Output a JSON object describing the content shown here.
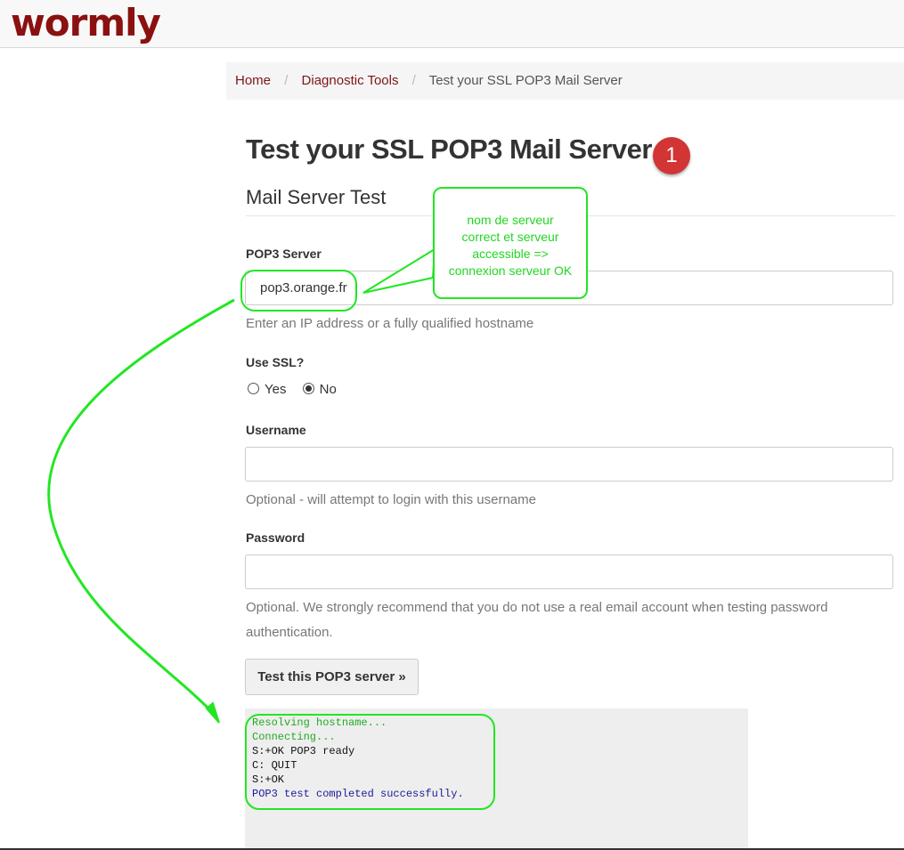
{
  "header": {
    "logo": "wormly"
  },
  "breadcrumb": {
    "items": [
      "Home",
      "Diagnostic Tools",
      "Test your SSL POP3 Mail Server"
    ],
    "separator": "/"
  },
  "page": {
    "title": "Test your SSL POP3 Mail Server",
    "step_badge": "1",
    "section_title": "Mail Server Test"
  },
  "form": {
    "server_label": "POP3 Server",
    "server_value": "pop3.orange.fr",
    "server_help": "Enter an IP address or a fully qualified hostname",
    "ssl_label": "Use SSL?",
    "ssl_options": [
      "Yes",
      "No"
    ],
    "ssl_selected": "No",
    "username_label": "Username",
    "username_value": "",
    "username_help": "Optional - will attempt to login with this username",
    "password_label": "Password",
    "password_value": "",
    "password_help_line1": "Optional. We strongly recommend that you do not use a real email account when testing password",
    "password_help_line2": "authentication.",
    "submit_label": "Test this POP3 server »"
  },
  "console": {
    "lines": [
      "Resolving hostname...",
      "Connecting...",
      "S:+OK POP3 ready",
      "C: QUIT",
      "S:+OK",
      "POP3 test completed successfully."
    ]
  },
  "annotation": {
    "callout_lines": [
      "nom de serveur",
      "correct et serveur",
      "accessible =>",
      "connexion serveur OK"
    ]
  },
  "colors": {
    "brand": "#8b1010",
    "link": "#7f1516",
    "annotation_green": "#22e622",
    "console_green": "#22aa22",
    "console_black": "#111111",
    "console_blue": "#1a1a9a",
    "badge_red": "#d33434"
  }
}
